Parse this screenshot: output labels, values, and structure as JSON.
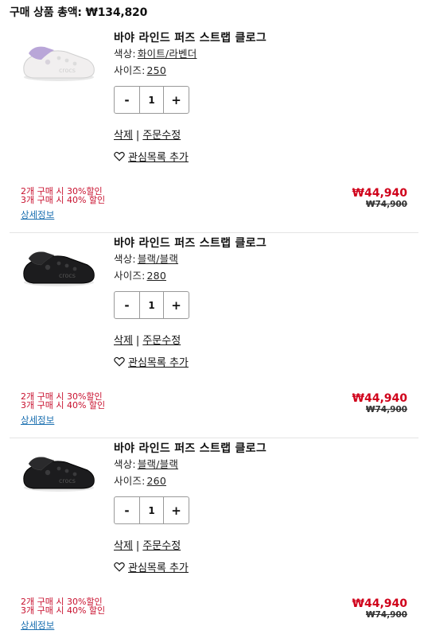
{
  "header": {
    "total_label": "구매 상품 총액:",
    "total_value": "₩134,820"
  },
  "items": [
    {
      "name": "바야 라인드 퍼즈 스트랩 클로그",
      "color_label": "색상:",
      "color_value": "화이트/라벤더",
      "size_label": "사이즈:",
      "size_value": "250",
      "qty_minus": "-",
      "qty": "1",
      "qty_plus": "+",
      "delete_label": "삭제",
      "sep": "|",
      "edit_label": "주문수정",
      "wishlist_label": "관심목록 추가",
      "promo_line1": "2개 구매 시 30%할인",
      "promo_line2": "3개 구매 시 40% 할인",
      "detail_label": "상세정보",
      "price": "₩44,940",
      "old_price": "₩74,900",
      "shoe_color": "#f1efef",
      "strap_color": "#b9a6d8"
    },
    {
      "name": "바야 라인드 퍼즈 스트랩 클로그",
      "color_label": "색상:",
      "color_value": "블랙/블랙",
      "size_label": "사이즈:",
      "size_value": "280",
      "qty_minus": "-",
      "qty": "1",
      "qty_plus": "+",
      "delete_label": "삭제",
      "sep": "|",
      "edit_label": "주문수정",
      "wishlist_label": "관심목록 추가",
      "promo_line1": "2개 구매 시 30%할인",
      "promo_line2": "3개 구매 시 40% 할인",
      "detail_label": "상세정보",
      "price": "₩44,940",
      "old_price": "₩74,900",
      "shoe_color": "#1c1c1e",
      "strap_color": "#2a2a2c"
    },
    {
      "name": "바야 라인드 퍼즈 스트랩 클로그",
      "color_label": "색상:",
      "color_value": "블랙/블랙",
      "size_label": "사이즈:",
      "size_value": "260",
      "qty_minus": "-",
      "qty": "1",
      "qty_plus": "+",
      "delete_label": "삭제",
      "sep": "|",
      "edit_label": "주문수정",
      "wishlist_label": "관심목록 추가",
      "promo_line1": "2개 구매 시 30%할인",
      "promo_line2": "3개 구매 시 40% 할인",
      "detail_label": "상세정보",
      "price": "₩44,940",
      "old_price": "₩74,900",
      "shoe_color": "#1c1c1e",
      "strap_color": "#2a2a2c"
    }
  ],
  "colors": {
    "accent_red": "#d0021b",
    "promo_red": "#c8102e",
    "link_blue": "#1a6fb0"
  }
}
